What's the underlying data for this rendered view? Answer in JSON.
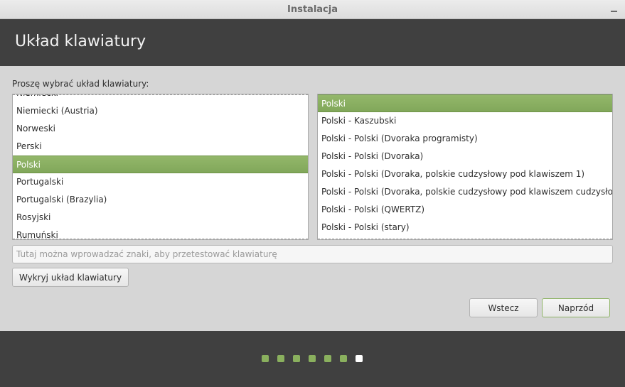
{
  "window": {
    "title": "Instalacja"
  },
  "header": {
    "title": "Układ klawiatury"
  },
  "prompt": "Proszę wybrać układ klawiatury:",
  "layouts": {
    "items": [
      "Niemiecki",
      "Niemiecki (Austria)",
      "Norweski",
      "Perski",
      "Polski",
      "Portugalski",
      "Portugalski (Brazylia)",
      "Rosyjski",
      "Rumuński"
    ],
    "selected": "Polski"
  },
  "variants": {
    "items": [
      "Polski",
      "Polski - Kaszubski",
      "Polski - Polski (Dvoraka programisty)",
      "Polski - Polski (Dvoraka)",
      "Polski - Polski (Dvoraka, polskie cudzysłowy pod klawiszem 1)",
      "Polski - Polski (Dvoraka, polskie cudzysłowy pod klawiszem cudzysłowu)",
      "Polski - Polski (QWERTZ)",
      "Polski - Polski (stary)"
    ],
    "selected": "Polski"
  },
  "test_input": {
    "value": "",
    "placeholder": "Tutaj można wprowadzać znaki, aby przetestować klawiaturę"
  },
  "buttons": {
    "detect": "Wykryj układ klawiatury",
    "back": "Wstecz",
    "forward": "Naprzód"
  },
  "progress": {
    "total_steps": 7,
    "current_step": 7
  },
  "colors": {
    "accent": "#87ad5e",
    "header_bg": "#404040",
    "window_bg": "#d6d6d6"
  }
}
